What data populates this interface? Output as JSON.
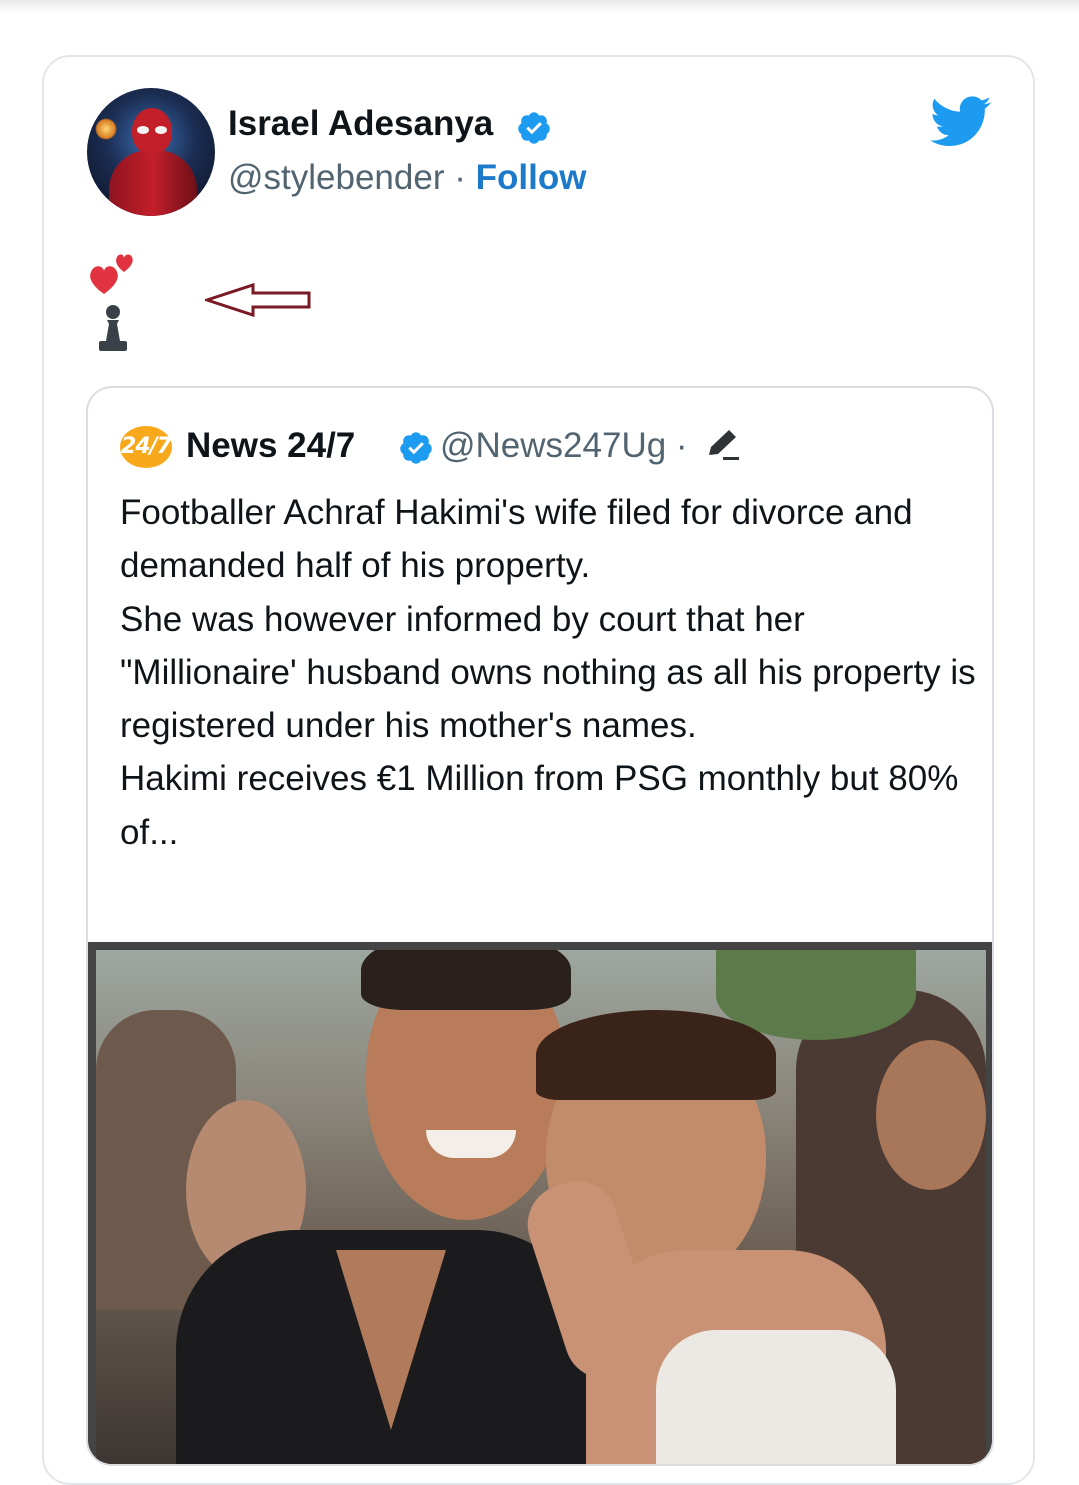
{
  "author": {
    "display_name": "Israel Adesanya",
    "handle": "@stylebender",
    "separator": "·",
    "follow_label": "Follow"
  },
  "tweet": {
    "emoji": [
      "hearts-emoji",
      "pawn-emoji",
      "left-arrow-annotation"
    ]
  },
  "quoted_tweet": {
    "logo_text": "24/7",
    "display_name": "News 24/7",
    "handle": "@News247Ug",
    "separator": "·",
    "paragraphs": [
      "Footballer Achraf Hakimi's wife filed for divorce and demanded half of his property.",
      "She was however informed by court that her \"Millionaire' husband owns nothing as all his property is registered under his mother's names.",
      "Hakimi receives €1 Million from PSG monthly but 80% of..."
    ]
  },
  "colors": {
    "twitter_blue": "#1d9bf0",
    "follow_blue": "#1d79c9",
    "logo_orange": "#f7a81b",
    "arrow_outline": "#7a1a24",
    "heart_red": "#e0323f"
  }
}
